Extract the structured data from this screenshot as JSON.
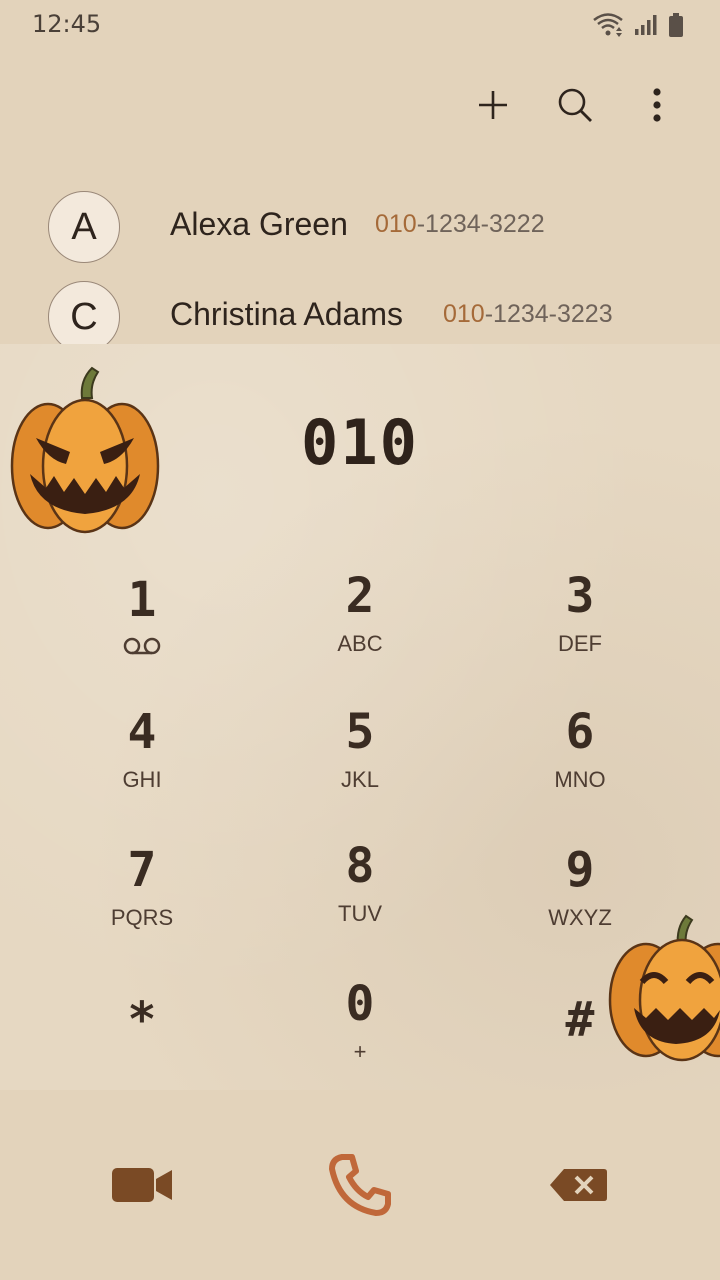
{
  "status": {
    "time": "12:45",
    "icons": [
      "wifi-icon",
      "signal-icon",
      "battery-icon"
    ]
  },
  "toolbar": {
    "icons": [
      "add-icon",
      "search-icon",
      "more-options-icon"
    ]
  },
  "contacts": [
    {
      "initial": "A",
      "name": "Alexa Green",
      "number_match": "010",
      "number_rest": "-1234-3222"
    },
    {
      "initial": "C",
      "name": "Christina Adams",
      "number_match": "010",
      "number_rest": "-1234-3223"
    }
  ],
  "dialer": {
    "number": "010",
    "keys": [
      {
        "digit": "1",
        "letters": "",
        "icon": "voicemail-icon"
      },
      {
        "digit": "2",
        "letters": "ABC"
      },
      {
        "digit": "3",
        "letters": "DEF"
      },
      {
        "digit": "4",
        "letters": "GHI"
      },
      {
        "digit": "5",
        "letters": "JKL"
      },
      {
        "digit": "6",
        "letters": "MNO"
      },
      {
        "digit": "7",
        "letters": "PQRS"
      },
      {
        "digit": "8",
        "letters": "TUV"
      },
      {
        "digit": "9",
        "letters": "WXYZ"
      },
      {
        "digit": "*",
        "letters": ""
      },
      {
        "digit": "0",
        "letters": "+"
      },
      {
        "digit": "#",
        "letters": ""
      }
    ]
  },
  "bottom_bar": {
    "icons": [
      "video-call-icon",
      "phone-call-icon",
      "backspace-icon"
    ]
  },
  "colors": {
    "background": "#e3d3bb",
    "accent": "#a56a39",
    "call": "#c0683a",
    "icon_brown": "#7a4a25"
  }
}
